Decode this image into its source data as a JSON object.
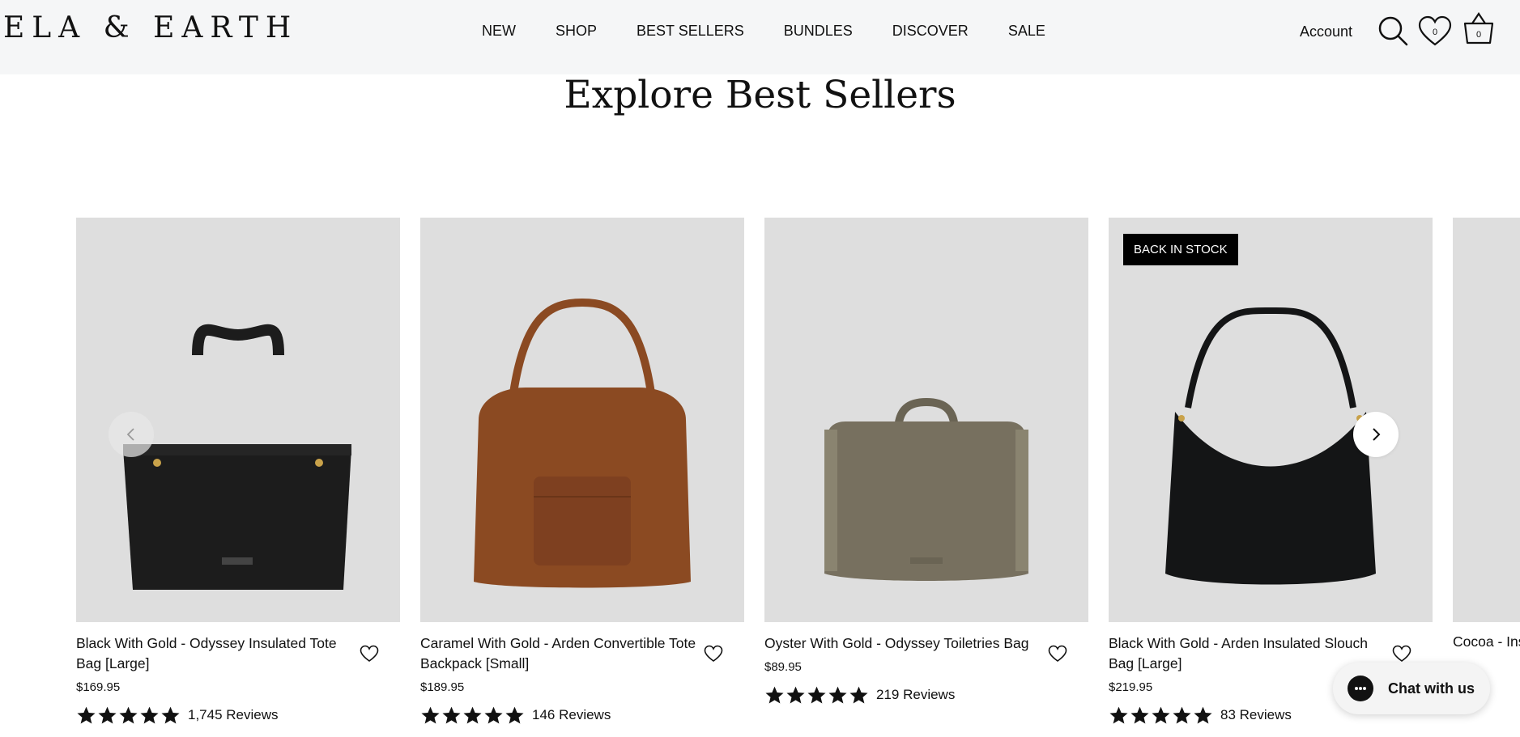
{
  "header": {
    "logo": "ELA & EARTH",
    "nav": [
      "NEW",
      "SHOP",
      "BEST SELLERS",
      "BUNDLES",
      "DISCOVER",
      "SALE"
    ],
    "account": "Account",
    "wishlist_count": "0",
    "cart_count": "0"
  },
  "section": {
    "title": "Explore Best Sellers"
  },
  "products": [
    {
      "name": "Black With Gold - Odyssey Insulated Tote Bag [Large]",
      "price": "$169.95",
      "reviews": "1,745 Reviews",
      "rating": 5,
      "image_color": "#1c1c1c",
      "badge": ""
    },
    {
      "name": "Caramel With Gold - Arden Convertible Tote Backpack [Small]",
      "price": "$189.95",
      "reviews": "146 Reviews",
      "rating": 5,
      "image_color": "#8b4a22",
      "badge": ""
    },
    {
      "name": "Oyster With Gold - Odyssey Toiletries Bag",
      "price": "$89.95",
      "reviews": "219 Reviews",
      "rating": 5,
      "image_color": "#77705f",
      "badge": ""
    },
    {
      "name": "Black With Gold - Arden Insulated Slouch Bag [Large]",
      "price": "$219.95",
      "reviews": "83 Reviews",
      "rating": 5,
      "image_color": "#141516",
      "badge": "BACK IN STOCK"
    }
  ],
  "partial_product": {
    "name": "Cocoa - Ins"
  },
  "chat": {
    "label": "Chat with us"
  },
  "colors": {
    "header_bg": "#f5f6f7",
    "card_bg": "#dedede",
    "badge_bg": "#000000"
  }
}
